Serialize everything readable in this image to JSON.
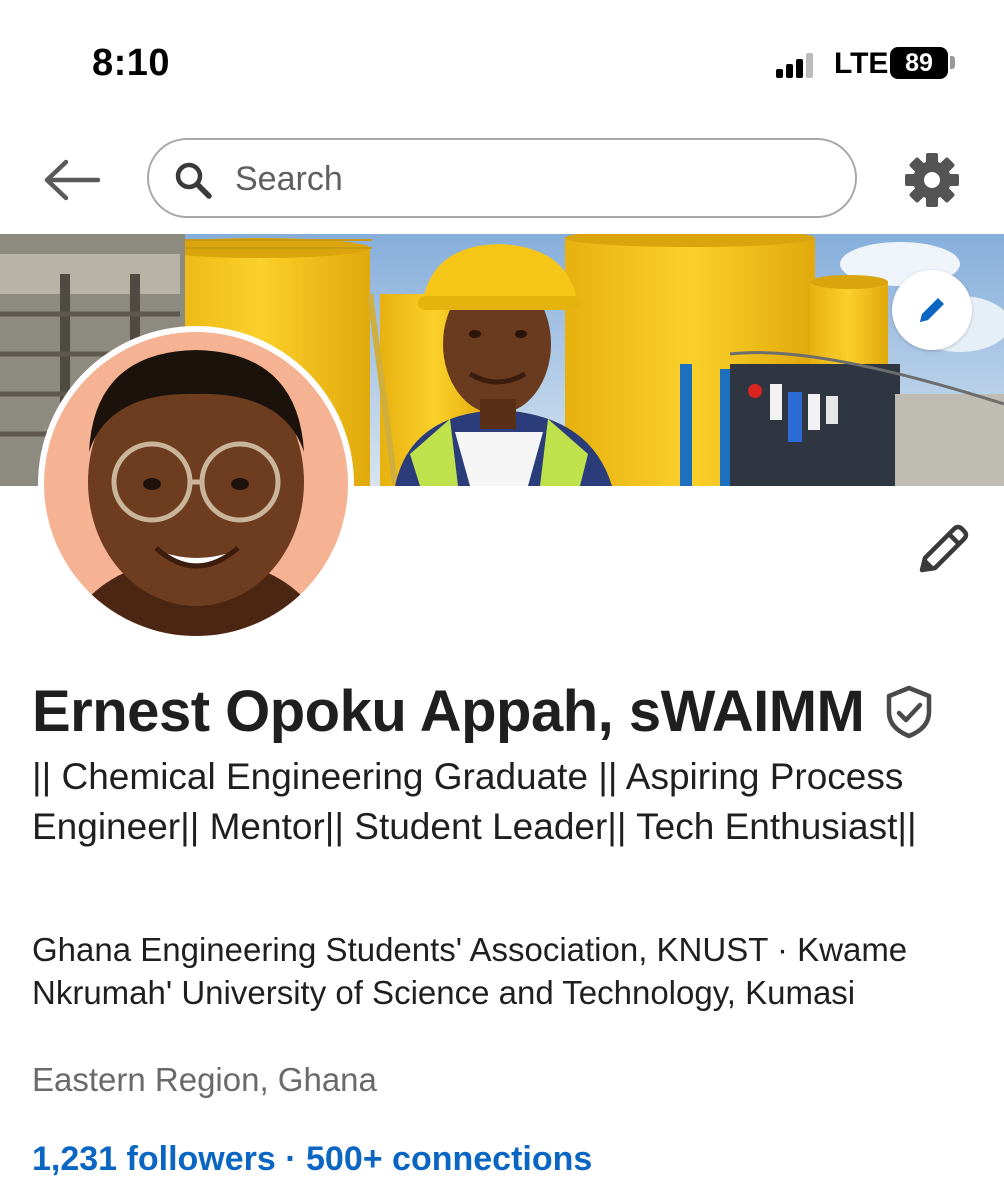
{
  "status_bar": {
    "time": "8:10",
    "network": "LTE",
    "battery": "89"
  },
  "nav": {
    "back_icon": "arrow-left-icon",
    "search_placeholder": "Search",
    "settings_icon": "gear-icon"
  },
  "profile": {
    "name": "Ernest Opoku Appah, sWAIMM",
    "verified_icon": "shield-check-icon",
    "headline": "|| Chemical Engineering Graduate || Aspiring Process Engineer|| Mentor|| Student Leader|| Tech Enthusiast||",
    "education": "Ghana Engineering Students' Association, KNUST · Kwame Nkrumah' University of Science and Technology, Kumasi",
    "location": "Eastern Region, Ghana",
    "followers": "1,231 followers",
    "separator": "·",
    "connections": "500+ connections"
  },
  "colors": {
    "link": "#0a66c2",
    "text": "#1f1f1f",
    "muted": "#6a6a6a",
    "avatar_bg": "#f6b394",
    "helmet": "#f3c613",
    "tank": "#f5c51c"
  }
}
